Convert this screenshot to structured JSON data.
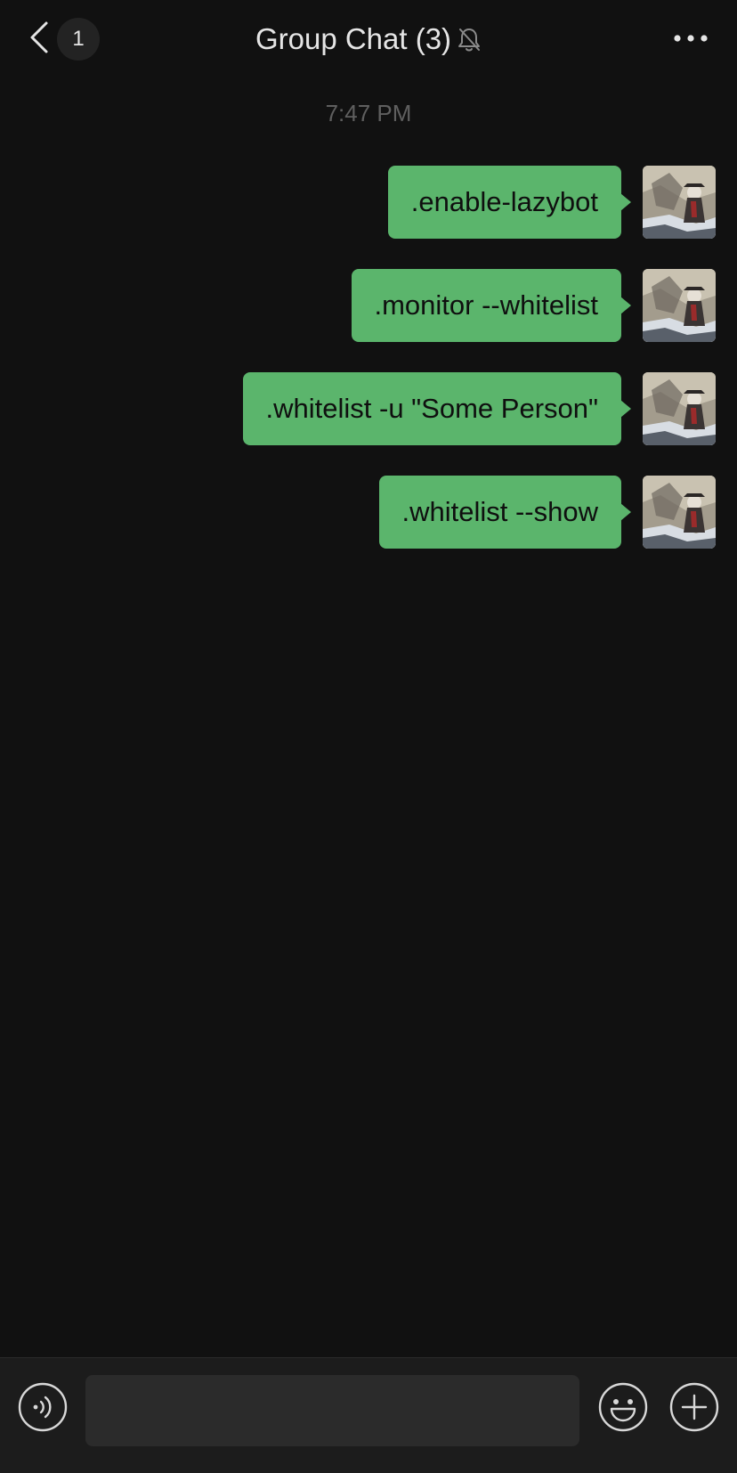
{
  "header": {
    "unread_count": "1",
    "title": "Group Chat (3)",
    "back_icon": "chevron-left-icon",
    "mute_icon": "bell-off-icon",
    "more_icon": "ellipsis-icon"
  },
  "conversation": {
    "timestamp": "7:47 PM",
    "messages": [
      {
        "text": ".enable-lazybot",
        "sender": "self"
      },
      {
        "text": ".monitor --whitelist",
        "sender": "self"
      },
      {
        "text": ".whitelist -u \"Some Person\"",
        "sender": "self"
      },
      {
        "text": ".whitelist --show",
        "sender": "self"
      }
    ]
  },
  "input_bar": {
    "message_value": "",
    "voice_icon": "voice-icon",
    "emoji_icon": "emoji-icon",
    "plus_icon": "plus-circle-icon"
  },
  "colors": {
    "background": "#111111",
    "bubble_self": "#5bb56c",
    "text_primary": "#e5e5e5",
    "timestamp": "#5f5f5f",
    "input_bar": "#1c1c1c"
  }
}
